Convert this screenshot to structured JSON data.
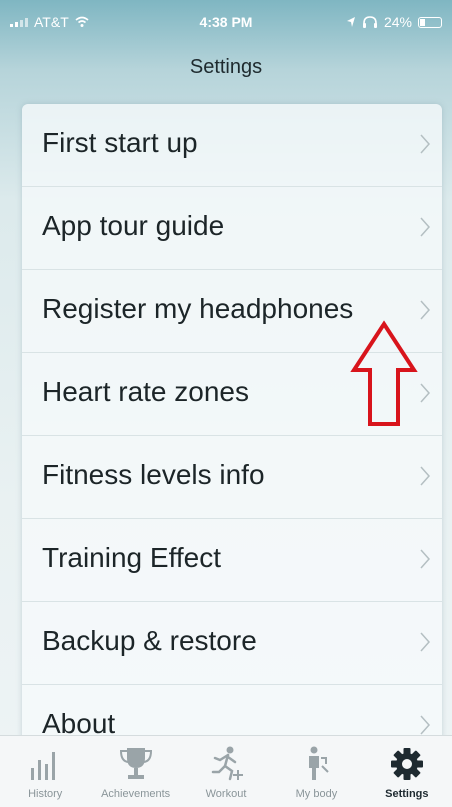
{
  "status_bar": {
    "carrier": "AT&T",
    "time": "4:38 PM",
    "battery": "24%"
  },
  "header": {
    "title": "Settings"
  },
  "settings": {
    "items": [
      {
        "label": "First start up"
      },
      {
        "label": "App tour guide"
      },
      {
        "label": "Register my headphones"
      },
      {
        "label": "Heart rate zones"
      },
      {
        "label": "Fitness levels info"
      },
      {
        "label": "Training Effect"
      },
      {
        "label": "Backup & restore"
      },
      {
        "label": "About"
      }
    ]
  },
  "tab_bar": {
    "tabs": [
      {
        "label": "History",
        "icon": "bar-chart-icon",
        "active": false
      },
      {
        "label": "Achievements",
        "icon": "trophy-icon",
        "active": false
      },
      {
        "label": "Workout",
        "icon": "runner-plus-icon",
        "active": false
      },
      {
        "label": "My body",
        "icon": "person-icon",
        "active": false
      },
      {
        "label": "Settings",
        "icon": "gear-icon",
        "active": true
      }
    ]
  },
  "colors": {
    "annotation_arrow": "#d8141c",
    "active_tab": "#1e2a30",
    "inactive_tab": "#8a9599"
  }
}
